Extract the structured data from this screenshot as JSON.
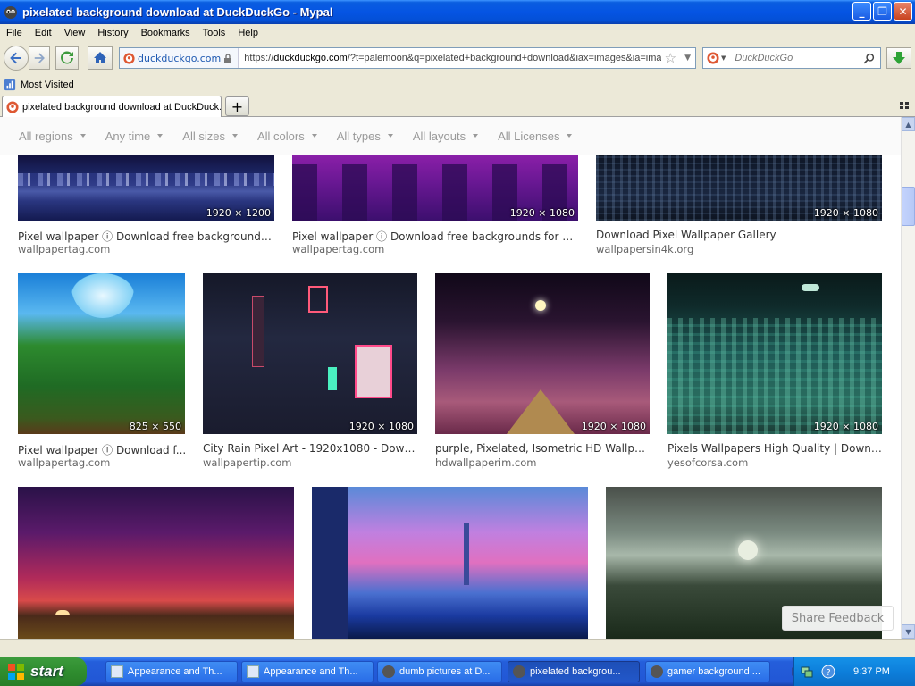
{
  "window": {
    "title": "pixelated background download at DuckDuckGo - Mypal"
  },
  "menu": [
    "File",
    "Edit",
    "View",
    "History",
    "Bookmarks",
    "Tools",
    "Help"
  ],
  "navbar": {
    "site_identity": "duckduckgo.com",
    "url_prefix": "https://",
    "url_host": "duckduckgo.com",
    "url_rest": "/?t=palemoon&q=pixelated+background+download&iax=images&ia=ima",
    "search_placeholder": "DuckDuckGo"
  },
  "bookmarks": {
    "most_visited": "Most Visited"
  },
  "tabs": [
    {
      "label": "pixelated background download at DuckDuck..."
    }
  ],
  "filters": [
    "All regions",
    "Any time",
    "All sizes",
    "All colors",
    "All types",
    "All layouts",
    "All Licenses"
  ],
  "results": [
    {
      "caption": "Pixel wallpaper ⓘ Download free backgrounds ...",
      "source": "wallpapertag.com",
      "dims": "1920 × 1200"
    },
    {
      "caption": "Pixel wallpaper ⓘ Download free backgrounds for d...",
      "source": "wallpapertag.com",
      "dims": "1920 × 1080"
    },
    {
      "caption": "Download Pixel Wallpaper Gallery",
      "source": "wallpapersin4k.org",
      "dims": "1920 × 1080"
    },
    {
      "caption": "Pixel wallpaper ⓘ Download f...",
      "source": "wallpapertag.com",
      "dims": "825 × 550"
    },
    {
      "caption": "City Rain Pixel Art - 1920x1080 - Downlo...",
      "source": "wallpapertip.com",
      "dims": "1920 × 1080"
    },
    {
      "caption": "purple, Pixelated, Isometric HD Wallpap...",
      "source": "hdwallpaperim.com",
      "dims": "1920 × 1080"
    },
    {
      "caption": "Pixels Wallpapers High Quality | Downlo...",
      "source": "yesofcorsa.com",
      "dims": "1920 × 1080"
    }
  ],
  "feedback": "Share Feedback",
  "taskbar": {
    "start": "start",
    "tasks": [
      {
        "label": "Appearance and Th..."
      },
      {
        "label": "Appearance and Th..."
      },
      {
        "label": "dumb pictures at D..."
      },
      {
        "label": "pixelated backgrou..."
      },
      {
        "label": "gamer background ..."
      }
    ],
    "clock": "9:37 PM"
  },
  "colors": {
    "titlebar": "#0554e3",
    "ddg_orange": "#de5833",
    "start_green": "#2f8d2f",
    "filter_text": "#999999"
  }
}
